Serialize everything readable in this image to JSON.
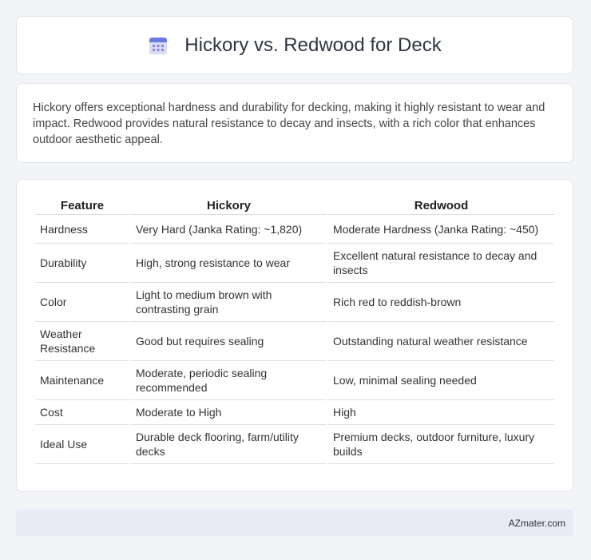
{
  "header": {
    "title": "Hickory vs. Redwood for Deck",
    "icon": "calendar-icon"
  },
  "intro": {
    "text": "Hickory offers exceptional hardness and durability for decking, making it highly resistant to wear and impact. Redwood provides natural resistance to decay and insects, with a rich color that enhances outdoor aesthetic appeal."
  },
  "table": {
    "headers": [
      "Feature",
      "Hickory",
      "Redwood"
    ],
    "rows": [
      [
        "Hardness",
        "Very Hard (Janka Rating: ~1,820)",
        "Moderate Hardness (Janka Rating: ~450)"
      ],
      [
        "Durability",
        "High, strong resistance to wear",
        "Excellent natural resistance to decay and insects"
      ],
      [
        "Color",
        "Light to medium brown with contrasting grain",
        "Rich red to reddish-brown"
      ],
      [
        "Weather Resistance",
        "Good but requires sealing",
        "Outstanding natural weather resistance"
      ],
      [
        "Maintenance",
        "Moderate, periodic sealing recommended",
        "Low, minimal sealing needed"
      ],
      [
        "Cost",
        "Moderate to High",
        "High"
      ],
      [
        "Ideal Use",
        "Durable deck flooring, farm/utility decks",
        "Premium decks, outdoor furniture, luxury builds"
      ]
    ]
  },
  "footer": {
    "brand": "AZmater.com"
  }
}
